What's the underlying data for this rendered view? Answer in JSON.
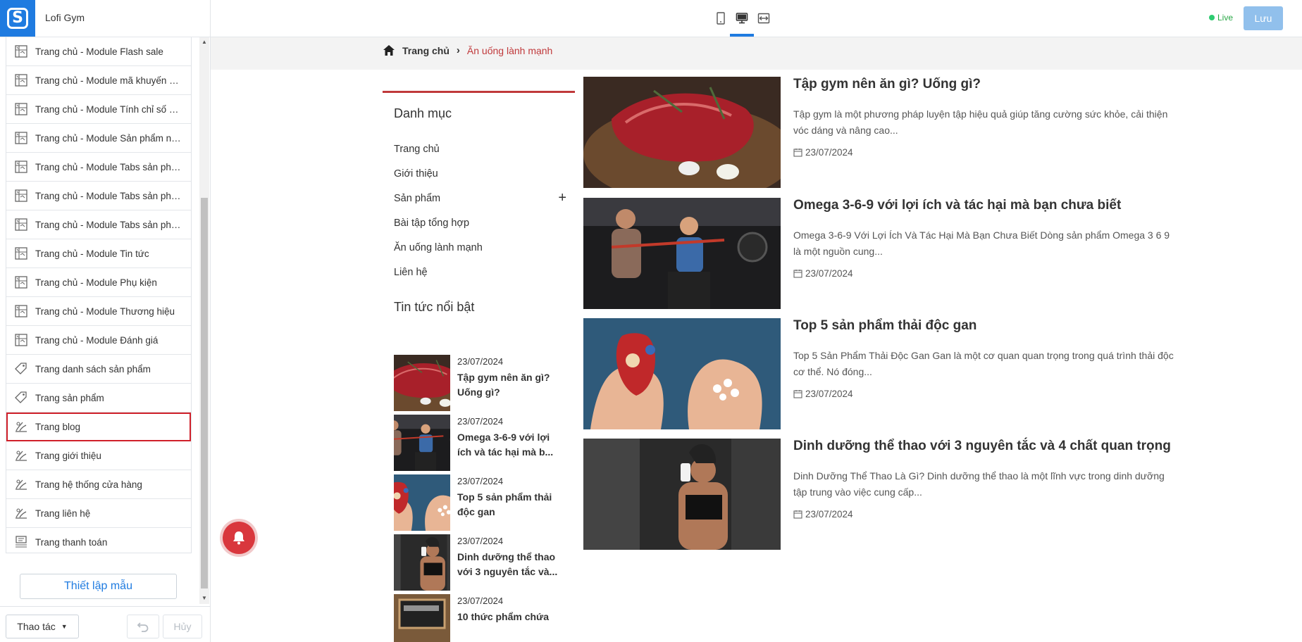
{
  "app": {
    "site_name": "Lofi Gym",
    "logo_letter": "S",
    "status": "Live",
    "save_label": "Lưu"
  },
  "sidebar": {
    "items": [
      {
        "label": "Trang chủ - Module Flash sale",
        "icon": "layout-icon"
      },
      {
        "label": "Trang chủ - Module mã khuyến mãi",
        "icon": "layout-icon"
      },
      {
        "label": "Trang chủ - Module Tính chỉ số BMI",
        "icon": "layout-icon"
      },
      {
        "label": "Trang chủ - Module Sản phẩm nổi bật",
        "icon": "layout-icon"
      },
      {
        "label": "Trang chủ - Module Tabs sản phẩm",
        "icon": "layout-icon"
      },
      {
        "label": "Trang chủ - Module Tabs sản phẩm",
        "icon": "layout-icon"
      },
      {
        "label": "Trang chủ - Module Tabs sản phẩm",
        "icon": "layout-icon"
      },
      {
        "label": "Trang chủ - Module Tin tức",
        "icon": "layout-icon"
      },
      {
        "label": "Trang chủ - Module Phụ kiện",
        "icon": "layout-icon"
      },
      {
        "label": "Trang chủ - Module Thương hiệu",
        "icon": "layout-icon"
      },
      {
        "label": "Trang chủ - Module Đánh giá",
        "icon": "layout-icon"
      },
      {
        "label": "Trang danh sách sản phẩm",
        "icon": "tag-icon"
      },
      {
        "label": "Trang sản phẩm",
        "icon": "tag-icon"
      },
      {
        "label": "Trang blog",
        "icon": "blog-icon",
        "selected": true
      },
      {
        "label": "Trang giới thiệu",
        "icon": "blog-icon"
      },
      {
        "label": "Trang hệ thống cửa hàng",
        "icon": "blog-icon"
      },
      {
        "label": "Trang liên hệ",
        "icon": "blog-icon"
      },
      {
        "label": "Trang thanh toán",
        "icon": "checkout-icon"
      }
    ],
    "setup_label": "Thiết lập mẫu",
    "ops_label": "Thao tác",
    "cancel_label": "Hủy"
  },
  "preview": {
    "breadcrumb": {
      "home": "Trang chủ",
      "current": "Ăn uống lành mạnh"
    },
    "category_title": "Danh mục",
    "categories": [
      "Trang chủ",
      "Giới thiệu",
      "Sản phẩm",
      "Bài tập tổng hợp",
      "Ăn uống lành mạnh",
      "Liên hệ"
    ],
    "hot_title": "Tin tức nổi bật",
    "hot_news": [
      {
        "date": "23/07/2024",
        "title": "Tập gym nên ăn gì? Uống gì?"
      },
      {
        "date": "23/07/2024",
        "title": "Omega 3-6-9 với lợi ích và tác hại mà b..."
      },
      {
        "date": "23/07/2024",
        "title": "Top 5 sản phẩm thải độc gan"
      },
      {
        "date": "23/07/2024",
        "title": "Dinh dưỡng thể thao với 3 nguyên tắc và..."
      },
      {
        "date": "23/07/2024",
        "title": "10 thức phẩm chứa"
      }
    ],
    "articles": [
      {
        "title": "Tập gym nên ăn gì? Uống gì?",
        "summary": "Tập gym là một phương pháp luyện tập hiệu quả giúp tăng cường sức khỏe, cải thiện vóc dáng và nâng cao...",
        "date": "23/07/2024"
      },
      {
        "title": "Omega 3-6-9 với lợi ích và tác hại mà bạn chưa biết",
        "summary": "Omega 3-6-9 Với Lợi Ích Và Tác Hại Mà Bạn Chưa Biết Dòng sản phẩm Omega 3 6 9 là một nguồn cung...",
        "date": "23/07/2024"
      },
      {
        "title": "Top 5 sản phẩm thải độc gan",
        "summary": "Top 5 Sản Phẩm Thải Độc Gan Gan là một cơ quan quan trọng trong quá trình thải độc cơ thể. Nó đóng...",
        "date": "23/07/2024"
      },
      {
        "title": "Dinh dưỡng thể thao với 3 nguyên tắc và 4 chất quan trọng",
        "summary": "Dinh Dưỡng Thể Thao Là Gì? Dinh dưỡng thể thao là một lĩnh vực trong dinh dưỡng tập trung vào việc cung cấp...",
        "date": "23/07/2024"
      }
    ]
  },
  "colors": {
    "accent": "#1f7be0",
    "brand_red": "#c0393b",
    "save_bg": "#91c0ec",
    "selected_outline": "#d0202a"
  }
}
